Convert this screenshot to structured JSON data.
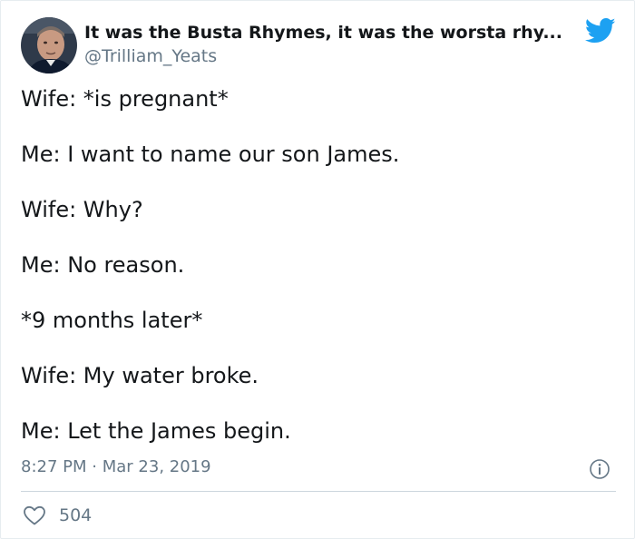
{
  "header": {
    "display_name": "It was the Busta Rhymes, it was the worsta rhy...",
    "handle": "@Trilliam_Yeats",
    "logo_icon": "twitter-bird-icon",
    "brand_color": "#1da1f2"
  },
  "body": {
    "lines": [
      "Wife: *is pregnant*",
      "Me: I want to name our son James.",
      "Wife: Why?",
      "Me: No reason.",
      "*9 months later*",
      "Wife: My water broke.",
      "Me: Let the James begin."
    ]
  },
  "meta": {
    "time": "8:27 PM",
    "separator": "·",
    "date": "Mar 23, 2019",
    "info_icon": "info-icon"
  },
  "actions": {
    "like_icon": "heart-icon",
    "like_count": "504"
  },
  "colors": {
    "text": "#14171a",
    "muted": "#657786",
    "divider": "#ccd6dd"
  }
}
